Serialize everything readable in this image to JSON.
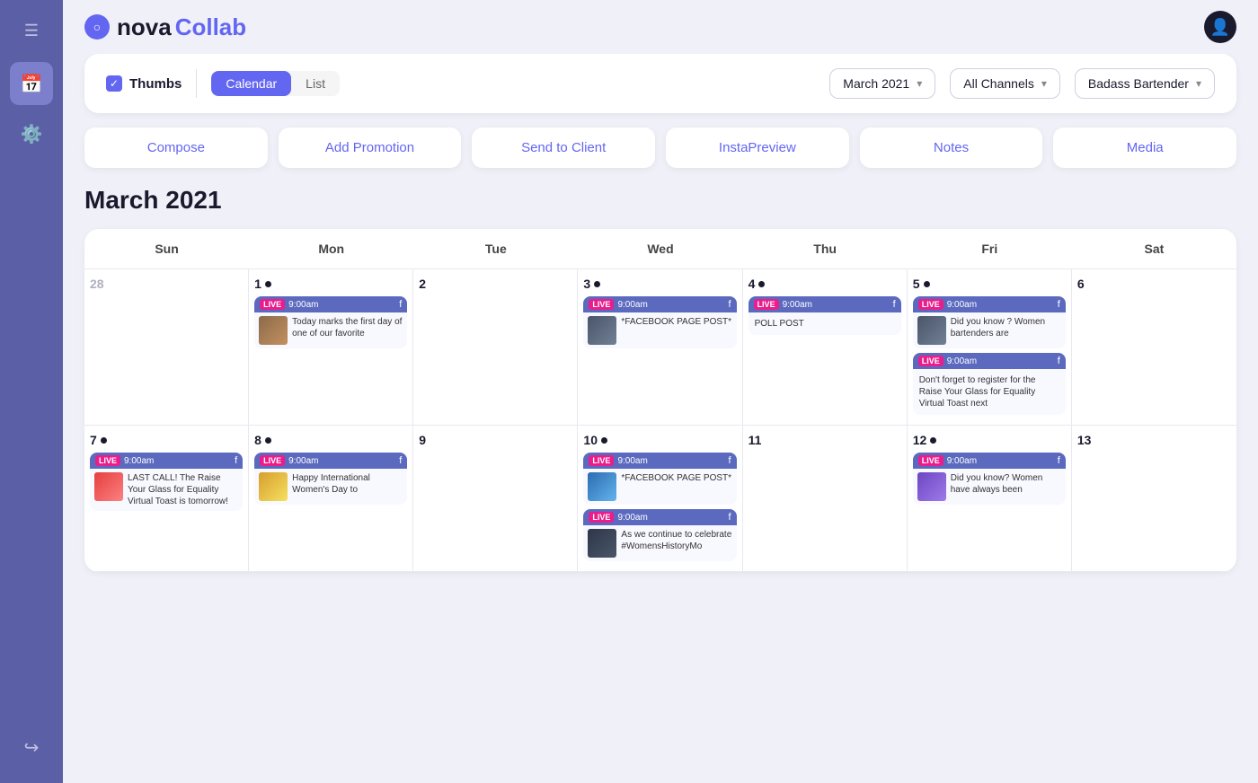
{
  "sidebar": {
    "menu_icon": "☰",
    "items": [
      {
        "id": "calendar",
        "icon": "📅",
        "active": true
      },
      {
        "id": "settings",
        "icon": "⚙️",
        "active": false
      }
    ],
    "bottom_items": [
      {
        "id": "logout",
        "icon": "↪"
      }
    ]
  },
  "header": {
    "logo_text_nova": "nova",
    "logo_text_collab": "Collab",
    "avatar_icon": "👤"
  },
  "toolbar": {
    "thumbs_label": "Thumbs",
    "view_calendar": "Calendar",
    "view_list": "List",
    "month_dropdown": "March 2021",
    "channels_dropdown": "All Channels",
    "brand_dropdown": "Badass Bartender"
  },
  "actions": [
    {
      "id": "compose",
      "label": "Compose"
    },
    {
      "id": "add-promotion",
      "label": "Add Promotion"
    },
    {
      "id": "send-to-client",
      "label": "Send to Client"
    },
    {
      "id": "instapreview",
      "label": "InstaPreview"
    },
    {
      "id": "notes",
      "label": "Notes"
    },
    {
      "id": "media",
      "label": "Media"
    }
  ],
  "calendar": {
    "title": "March 2021",
    "day_headers": [
      "Sun",
      "Mon",
      "Tue",
      "Wed",
      "Thu",
      "Fri",
      "Sat"
    ],
    "cells": [
      {
        "date": "28",
        "muted": true,
        "dot": false,
        "posts": []
      },
      {
        "date": "1",
        "muted": false,
        "dot": true,
        "posts": [
          {
            "time": "9:00am",
            "thumb": "thumb-women",
            "text": "Today marks the first day of one of our favorite"
          }
        ]
      },
      {
        "date": "2",
        "muted": false,
        "dot": false,
        "posts": []
      },
      {
        "date": "3",
        "muted": false,
        "dot": true,
        "posts": [
          {
            "time": "9:00am",
            "thumb": "thumb-bartender",
            "text": "*FACEBOOK PAGE POST*"
          }
        ]
      },
      {
        "date": "4",
        "muted": false,
        "dot": true,
        "posts": [
          {
            "time": "9:00am",
            "thumb": null,
            "text": "POLL POST"
          }
        ]
      },
      {
        "date": "5",
        "muted": false,
        "dot": true,
        "posts": [
          {
            "time": "9:00am",
            "thumb": "thumb-bartender",
            "text": "Did you know ? Women bartenders are"
          },
          {
            "time": "9:00am",
            "thumb": "thumb-register",
            "text": "Don't forget to register for the Raise Your Glass for Equality Virtual Toast next"
          }
        ]
      },
      {
        "date": "6",
        "muted": false,
        "dot": false,
        "posts": []
      },
      {
        "date": "7",
        "muted": false,
        "dot": true,
        "posts": [
          {
            "time": "9:00am",
            "thumb": "thumb-lastcall",
            "text": "LAST CALL! The Raise Your Glass for Equality Virtual Toast is tomorrow!"
          }
        ]
      },
      {
        "date": "8",
        "muted": false,
        "dot": true,
        "posts": [
          {
            "time": "9:00am",
            "thumb": "thumb-iwd",
            "text": "Happy International Women's Day to"
          }
        ]
      },
      {
        "date": "9",
        "muted": false,
        "dot": false,
        "posts": []
      },
      {
        "date": "10",
        "muted": false,
        "dot": true,
        "posts": [
          {
            "time": "9:00am",
            "thumb": "thumb-fb10",
            "text": "*FACEBOOK PAGE POST*"
          },
          {
            "time": "9:00am",
            "thumb": "thumb-mixologist",
            "text": "As we continue to celebrate #WomensHistoryMo"
          }
        ]
      },
      {
        "date": "11",
        "muted": false,
        "dot": false,
        "posts": []
      },
      {
        "date": "12",
        "muted": false,
        "dot": true,
        "posts": [
          {
            "time": "9:00am",
            "thumb": "thumb-women2",
            "text": "Did you know? Women have always been"
          }
        ]
      },
      {
        "date": "13",
        "muted": false,
        "dot": false,
        "posts": []
      }
    ]
  }
}
